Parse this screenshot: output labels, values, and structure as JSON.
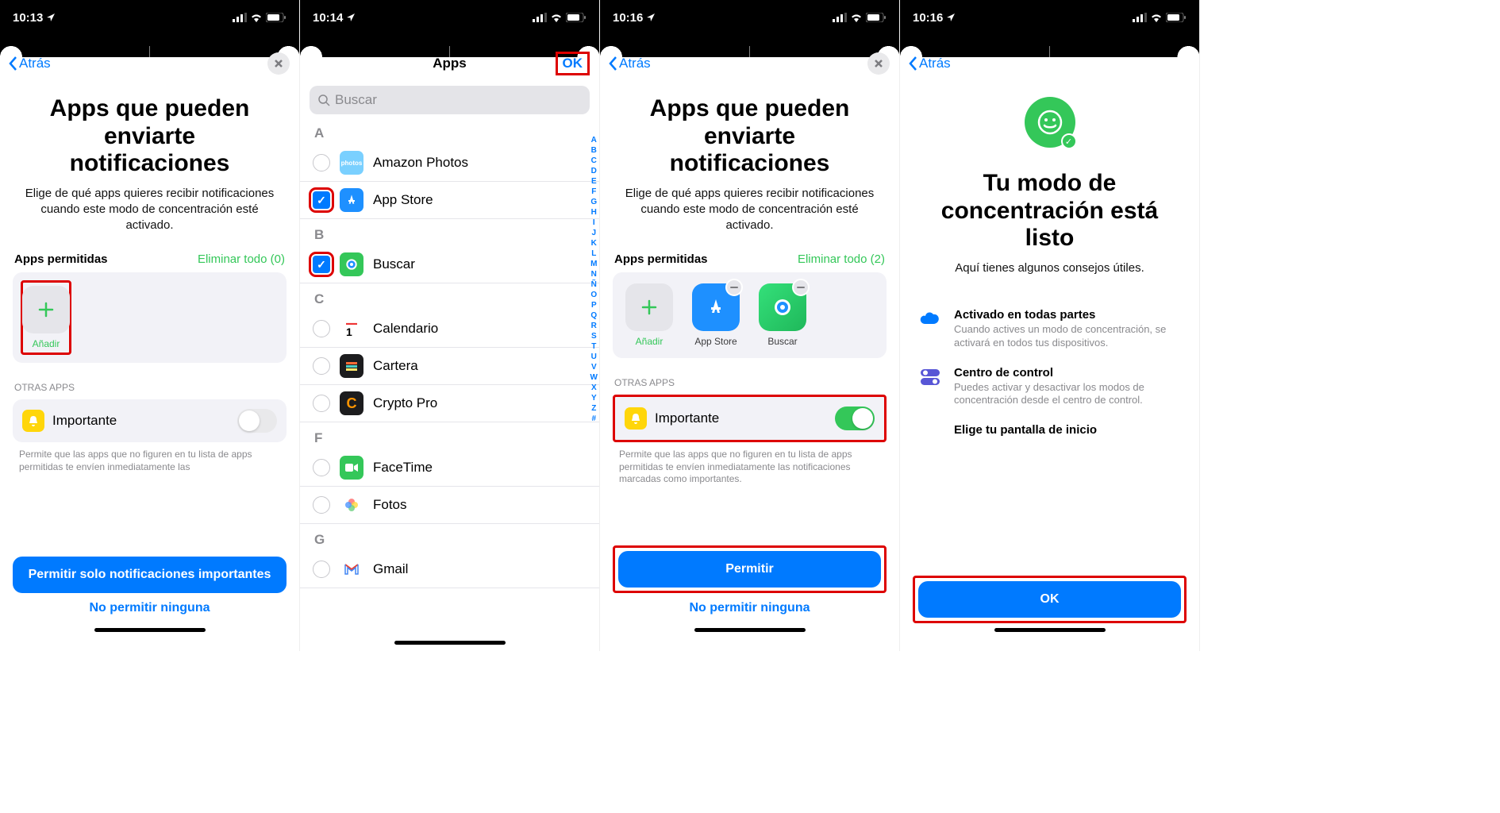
{
  "s1": {
    "time": "10:13",
    "back": "Atrás",
    "title": "Apps que pueden enviarte notificaciones",
    "desc": "Elige de qué apps quieres recibir notificaciones cuando este modo de concentración esté activado.",
    "permitted_head": "Apps permitidas",
    "del_all": "Eliminar todo (0)",
    "add_label": "Añadir",
    "other_head": "OTRAS APPS",
    "importante": "Importante",
    "footnote": "Permite que las apps que no figuren en tu lista de apps permitidas te envíen inmediatamente las",
    "primary_btn": "Permitir solo notificaciones importantes",
    "secondary_btn": "No permitir ninguna"
  },
  "s2": {
    "time": "10:14",
    "title": "Apps",
    "ok": "OK",
    "search_ph": "Buscar",
    "apps": [
      {
        "section": "A",
        "items": [
          {
            "name": "Amazon Photos",
            "checked": false,
            "icon_bg": "#7ad0ff"
          },
          {
            "name": "App Store",
            "checked": true,
            "icon_bg": "#1e90ff"
          }
        ]
      },
      {
        "section": "B",
        "items": [
          {
            "name": "Buscar",
            "checked": true,
            "icon_bg": "#34c759"
          }
        ]
      },
      {
        "section": "C",
        "items": [
          {
            "name": "Calendario",
            "checked": false,
            "icon_bg": "#fff"
          },
          {
            "name": "Cartera",
            "checked": false,
            "icon_bg": "#1c1c1e"
          },
          {
            "name": "Crypto Pro",
            "checked": false,
            "icon_bg": "#1c1c1e"
          }
        ]
      },
      {
        "section": "F",
        "items": [
          {
            "name": "FaceTime",
            "checked": false,
            "icon_bg": "#34c759"
          },
          {
            "name": "Fotos",
            "checked": false,
            "icon_bg": "#fff"
          }
        ]
      },
      {
        "section": "G",
        "items": [
          {
            "name": "Gmail",
            "checked": false,
            "icon_bg": "#fff"
          }
        ]
      }
    ],
    "index": "ABCDEFGHIJKLMNÑOPQRSTUVWXYZ#"
  },
  "s3": {
    "time": "10:16",
    "back": "Atrás",
    "title": "Apps que pueden enviarte notificaciones",
    "desc": "Elige de qué apps quieres recibir notificaciones cuando este modo de concentración esté activado.",
    "permitted_head": "Apps permitidas",
    "del_all": "Eliminar todo (2)",
    "add_label": "Añadir",
    "apps": [
      {
        "name": "App Store"
      },
      {
        "name": "Buscar"
      }
    ],
    "other_head": "OTRAS APPS",
    "importante": "Importante",
    "footnote": "Permite que las apps que no figuren en tu lista de apps permitidas te envíen inmediatamente las notificaciones marcadas como importantes.",
    "primary_btn": "Permitir",
    "secondary_btn": "No permitir ninguna"
  },
  "s4": {
    "time": "10:16",
    "back": "Atrás",
    "title": "Tu modo de concentración está listo",
    "desc": "Aquí tienes algunos consejos útiles.",
    "tips": [
      {
        "title": "Activado en todas partes",
        "desc": "Cuando actives un modo de concentración, se activará en todos tus dispositivos."
      },
      {
        "title": "Centro de control",
        "desc": "Puedes activar y desactivar los modos de concentración desde el centro de control."
      },
      {
        "title": "Elige tu pantalla de inicio",
        "desc": ""
      }
    ],
    "ok_btn": "OK"
  }
}
